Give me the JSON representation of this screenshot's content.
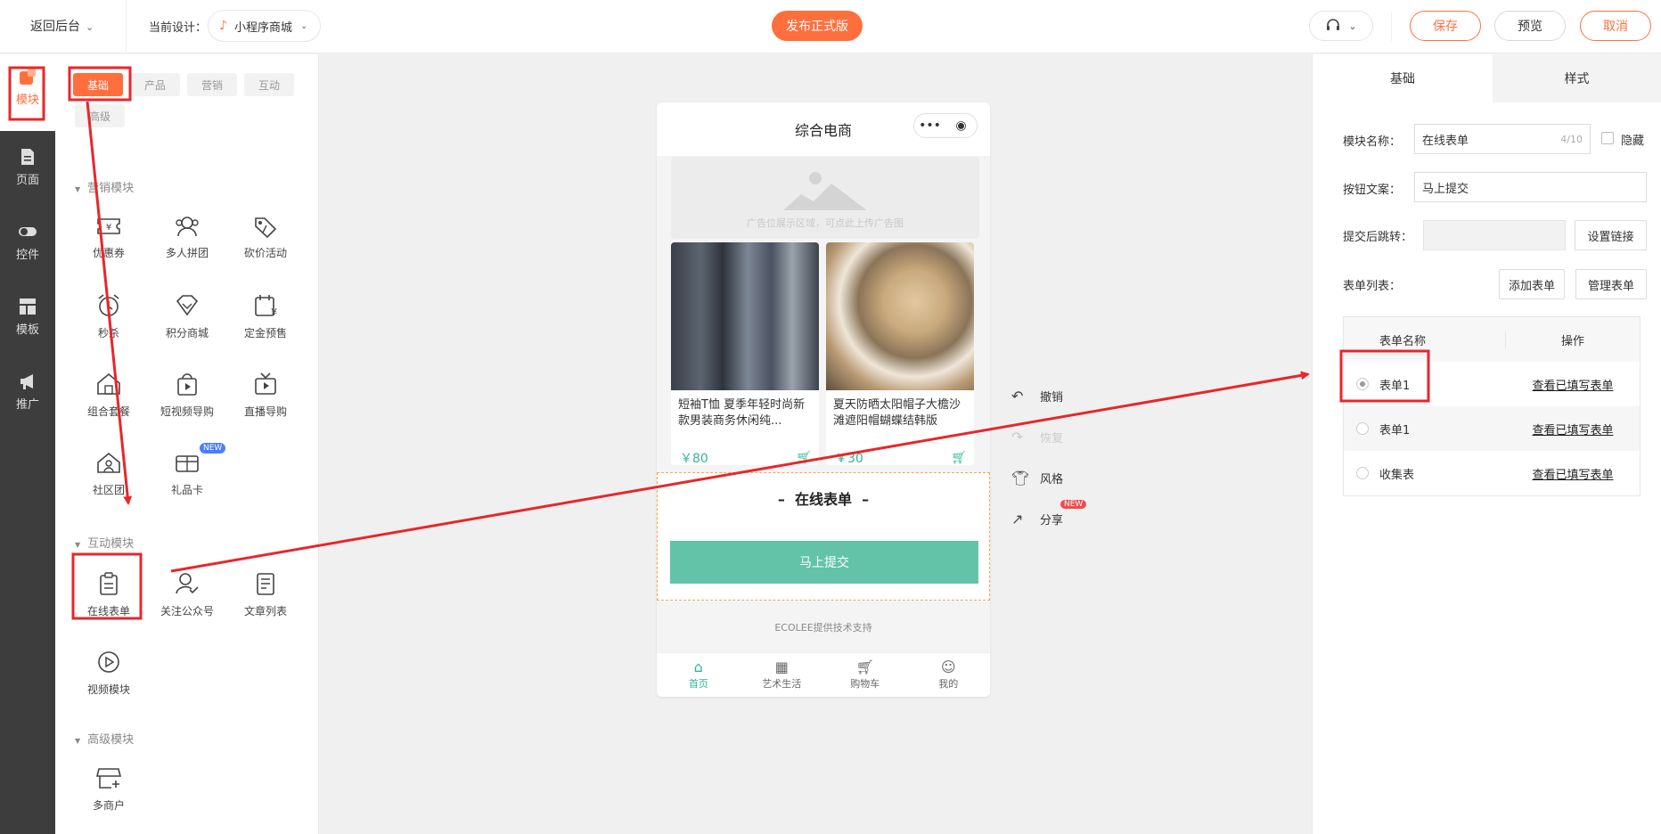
{
  "topbar": {
    "back_label": "返回后台",
    "current_design_label": "当前设计：",
    "design_name": "小程序商城",
    "publish_label": "发布正式版",
    "save_label": "保存",
    "preview_label": "预览",
    "cancel_label": "取消"
  },
  "sidenav": {
    "items": [
      {
        "label": "模块",
        "icon": "module-icon"
      },
      {
        "label": "页面",
        "icon": "page-icon"
      },
      {
        "label": "控件",
        "icon": "toggle-icon"
      },
      {
        "label": "模板",
        "icon": "template-icon"
      },
      {
        "label": "推广",
        "icon": "megaphone-icon"
      }
    ]
  },
  "panel": {
    "tabs": [
      "基础",
      "产品",
      "营销",
      "互动",
      "高级"
    ],
    "sections": {
      "marketing": {
        "title": "营销模块",
        "items": [
          "优惠券",
          "多人拼团",
          "砍价活动",
          "秒杀",
          "积分商城",
          "定金预售",
          "组合套餐",
          "短视频导购",
          "直播导购",
          "社区团",
          "礼品卡"
        ]
      },
      "interactive": {
        "title": "互动模块",
        "items": [
          "在线表单",
          "关注公众号",
          "文章列表",
          "视频模块"
        ]
      },
      "advanced": {
        "title": "高级模块",
        "items": [
          "多商户"
        ]
      }
    },
    "new_badge": "NEW"
  },
  "phone": {
    "title": "综合电商",
    "ad_text": "广告位展示区域，可点此上传广告图",
    "products": [
      {
        "title": "短袖T恤 夏季年轻时尚新款男装商务休闲纯...",
        "price": "￥80"
      },
      {
        "title": "夏天防晒太阳帽子大檐沙滩遮阳帽蝴蝶结韩版",
        "price": "￥30"
      }
    ],
    "form_title": "在线表单",
    "form_button": "马上提交",
    "footer": "ECOLEE提供技术支持",
    "tabbar": [
      "首页",
      "艺术生活",
      "购物车",
      "我的"
    ]
  },
  "actions": {
    "undo": "撤销",
    "redo": "恢复",
    "style": "风格",
    "share": "分享",
    "new_badge": "NEW"
  },
  "rpanel": {
    "tabs": [
      "基础",
      "样式"
    ],
    "module_name_label": "模块名称：",
    "module_name_value": "在线表单",
    "module_name_count": "4/10",
    "hide_label": "隐藏",
    "button_text_label": "按钮文案：",
    "button_text_value": "马上提交",
    "redirect_label": "提交后跳转：",
    "set_link_label": "设置链接",
    "form_list_label": "表单列表：",
    "add_form_label": "添加表单",
    "manage_form_label": "管理表单",
    "table": {
      "headers": [
        "表单名称",
        "操作"
      ],
      "rows": [
        {
          "name": "表单1",
          "op": "查看已填写表单",
          "selected": true
        },
        {
          "name": "表单1",
          "op": "查看已填写表单",
          "selected": false
        },
        {
          "name": "收集表",
          "op": "查看已填写表单",
          "selected": false
        }
      ]
    }
  },
  "colors": {
    "accent": "#ff6f3d",
    "teal": "#62c3a8",
    "annotation": "#e8262b"
  }
}
